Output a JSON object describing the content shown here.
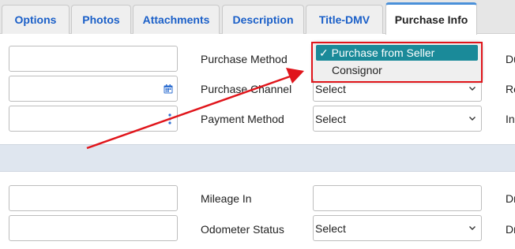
{
  "tabs": [
    {
      "label": "Options"
    },
    {
      "label": "Photos"
    },
    {
      "label": "Attachments"
    },
    {
      "label": "Description"
    },
    {
      "label": "Title-DMV"
    },
    {
      "label": "Purchase Info"
    }
  ],
  "active_tab": "Purchase Info",
  "purchase_section": {
    "purchase_method_label": "Purchase Method",
    "purchase_channel_label": "Purchase Channel",
    "purchase_channel_value": "Select",
    "payment_method_label": "Payment Method",
    "payment_method_value": "Select",
    "right_labels": [
      "Du",
      "Re",
      "In"
    ]
  },
  "purchase_method_dropdown": {
    "options": [
      "Purchase from Seller",
      "Consignor"
    ],
    "selected": "Purchase from Seller",
    "check_glyph": "✓"
  },
  "mileage_section": {
    "mileage_in_label": "Mileage In",
    "odometer_status_label": "Odometer Status",
    "odometer_status_value": "Select",
    "right_labels": [
      "Dr",
      "Dr"
    ]
  },
  "icons": {
    "calendar": "calendar-icon",
    "more": "more-vertical-icon",
    "chevron": "chevron-down-icon"
  },
  "colors": {
    "tab_text": "#1a5fc8",
    "active_tab_border": "#4a90d9",
    "selected_option_bg": "#1a8a99",
    "annotation_red": "#e0151b"
  }
}
